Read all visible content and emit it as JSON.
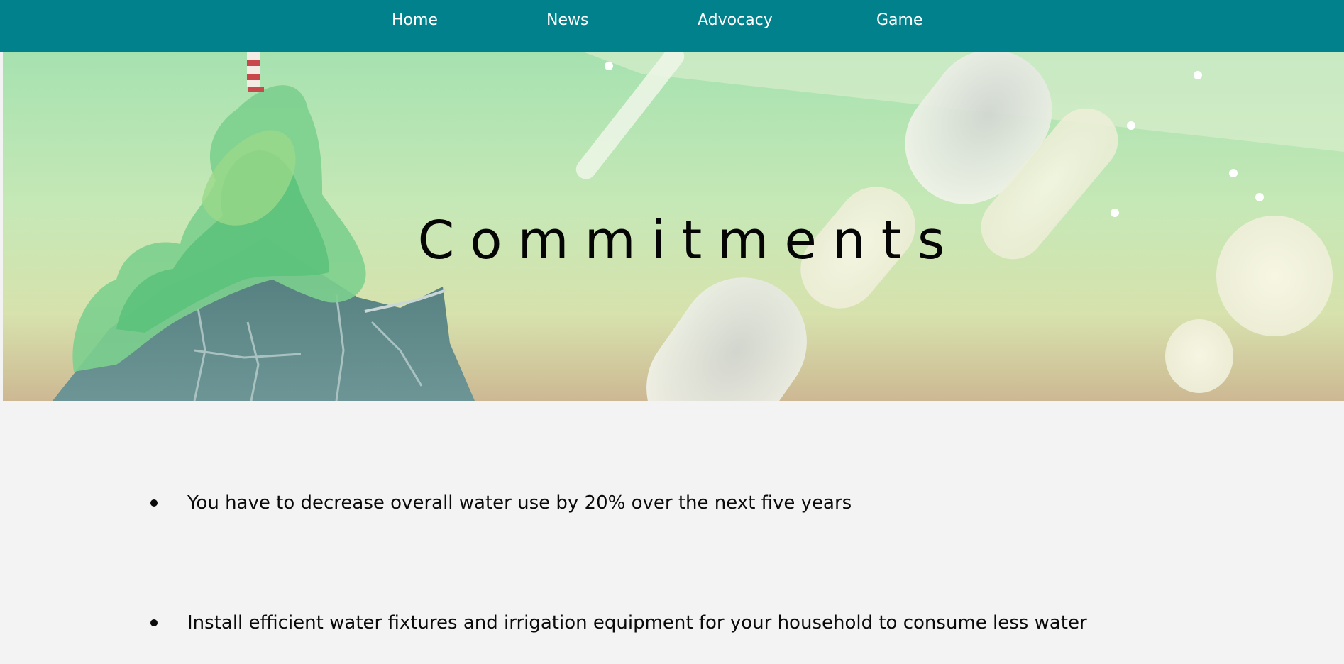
{
  "nav": {
    "items": [
      {
        "label": "Home"
      },
      {
        "label": "News"
      },
      {
        "label": "Advocacy"
      },
      {
        "label": "Game"
      }
    ],
    "background": "#00818c",
    "text_color": "#ffffff"
  },
  "hero": {
    "title": "Commitments",
    "illustration": "lighthouse-island-painting"
  },
  "commitments": {
    "items": [
      {
        "text": "You have to decrease overall water use by 20% over the next five years"
      },
      {
        "text": "Install efficient water fixtures and irrigation equipment for your household to consume less water"
      }
    ]
  }
}
